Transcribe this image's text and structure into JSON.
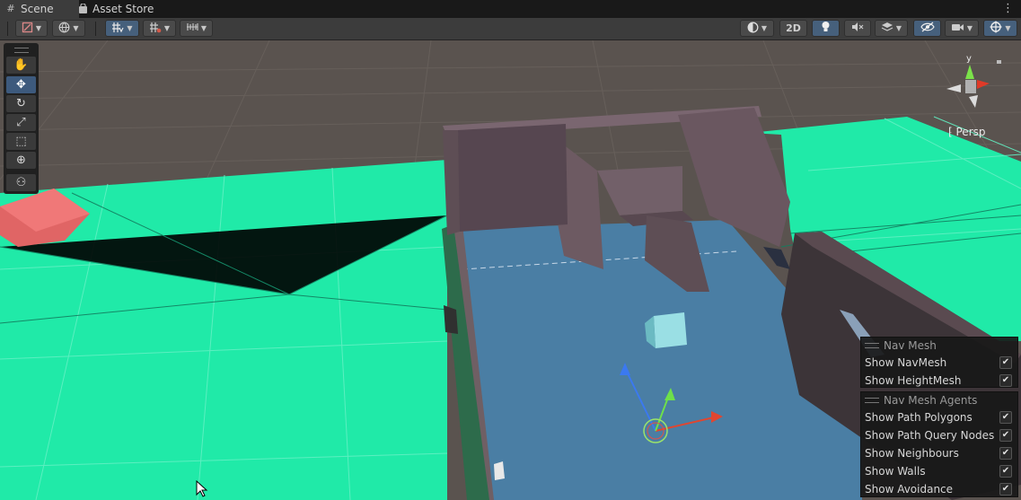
{
  "tabs": [
    {
      "label": "Scene",
      "icon": "grid-icon",
      "active": true
    },
    {
      "label": "Asset Store",
      "icon": "shopping-bag-icon",
      "active": false
    }
  ],
  "toolbar": {
    "draw_mode_icon": "draw-mode-icon",
    "global_icon": "globe-icon",
    "grid_snap_icon": "grid-snap-icon",
    "increment_snap_icon": "increment-snap-icon",
    "ruler_icon": "ruler-icon",
    "shading_icon": "shading-sphere-icon",
    "two_d_label": "2D",
    "lighting_icon": "lightbulb-icon",
    "audio_icon": "audio-mute-icon",
    "effects_icon": "effects-layers-icon",
    "visibility_icon": "visibility-icon",
    "camera_icon": "camera-icon",
    "gizmos_icon": "gizmos-icon"
  },
  "tools": [
    {
      "name": "hand-tool",
      "icon": "hand-icon",
      "glyph": "✋",
      "active": false
    },
    {
      "name": "move-tool",
      "icon": "move-icon",
      "glyph": "✥",
      "active": true
    },
    {
      "name": "rotate-tool",
      "icon": "rotate-icon",
      "glyph": "↻",
      "active": false
    },
    {
      "name": "scale-tool",
      "icon": "scale-icon",
      "glyph": "⤢",
      "active": false
    },
    {
      "name": "rect-tool",
      "icon": "rect-icon",
      "glyph": "⬚",
      "active": false
    },
    {
      "name": "transform-tool",
      "icon": "transform-icon",
      "glyph": "⊕",
      "active": false
    },
    {
      "name": "custom-tool",
      "icon": "custom-tool-icon",
      "glyph": "⚇",
      "active": false
    }
  ],
  "scene": {
    "projection_label": "Persp",
    "gizmo_axis_label": "y"
  },
  "nav_mesh_panel": {
    "title": "Nav Mesh",
    "options": [
      {
        "label": "Show NavMesh",
        "checked": true
      },
      {
        "label": "Show HeightMesh",
        "checked": true
      }
    ]
  },
  "nav_mesh_agents_panel": {
    "title": "Nav Mesh Agents",
    "options": [
      {
        "label": "Show Path Polygons",
        "checked": true
      },
      {
        "label": "Show Path Query Nodes",
        "checked": true
      },
      {
        "label": "Show Neighbours",
        "checked": true
      },
      {
        "label": "Show Walls",
        "checked": true
      },
      {
        "label": "Show Avoidance",
        "checked": true
      }
    ]
  },
  "colors": {
    "navmesh": "#20eaa8",
    "ground": "#5b5450",
    "walls": "#5e4e55",
    "water_blue": "#4a7ea4",
    "accent": "#46607c"
  }
}
